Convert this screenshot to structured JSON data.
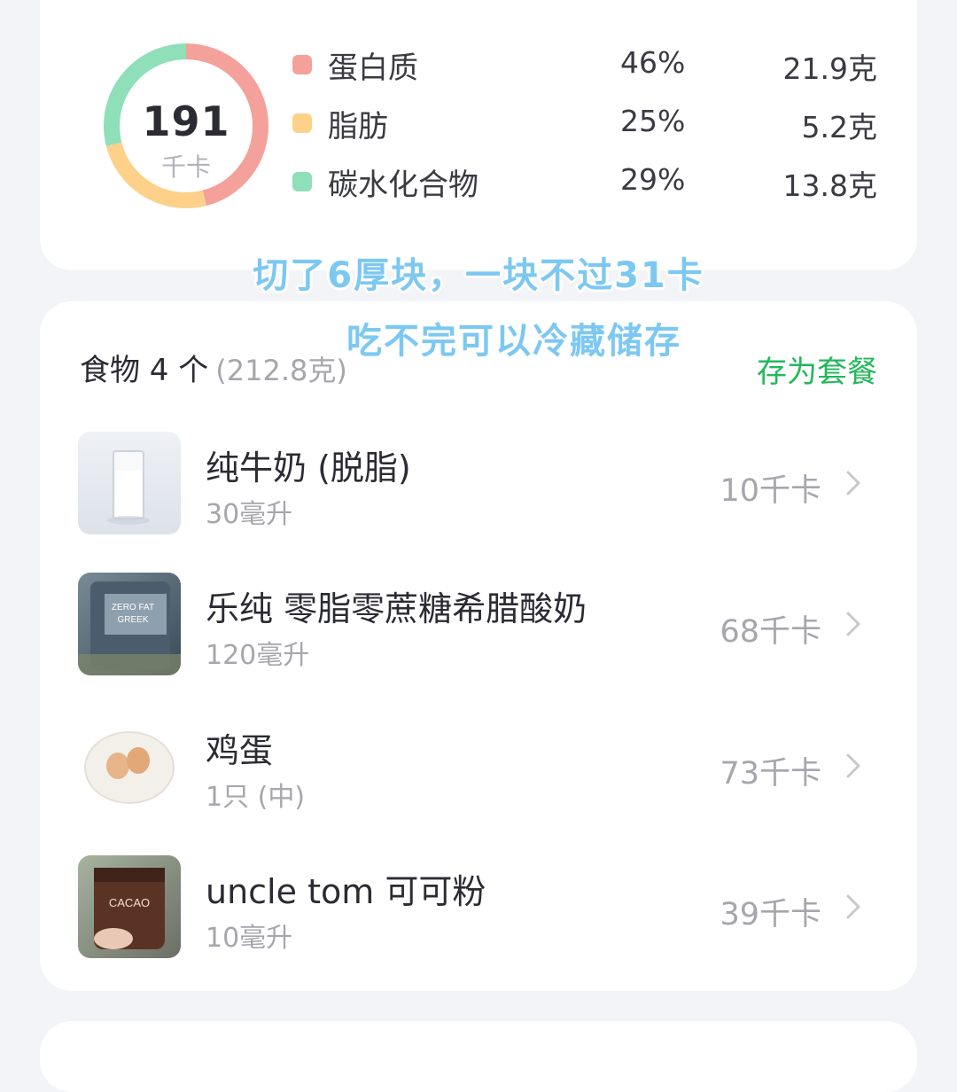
{
  "summary": {
    "calories": "191",
    "calories_unit": "千卡",
    "macros": [
      {
        "name": "蛋白质",
        "percent": "46%",
        "grams": "21.9克",
        "color": "#f4a19b",
        "fraction": 0.46
      },
      {
        "name": "脂肪",
        "percent": "25%",
        "grams": "5.2克",
        "color": "#fdd18a",
        "fraction": 0.25
      },
      {
        "name": "碳水化合物",
        "percent": "29%",
        "grams": "13.8克",
        "color": "#8fdfb9",
        "fraction": 0.29
      }
    ]
  },
  "note": {
    "line1": "切了6厚块，一块不过31卡",
    "line2": "吃不完可以冷藏储存"
  },
  "food_list": {
    "title": "食物 4 个",
    "total_weight": "(212.8克)",
    "save_meal_label": "存为套餐",
    "items": [
      {
        "name": "纯牛奶 (脱脂)",
        "qty": "30毫升",
        "kcal": "10千卡",
        "icon": "milk-glass-photo"
      },
      {
        "name": "乐纯 零脂零蔗糖希腊酸奶",
        "qty": "120毫升",
        "kcal": "68千卡",
        "icon": "yogurt-package-photo"
      },
      {
        "name": "鸡蛋",
        "qty": "1只 (中)",
        "kcal": "73千卡",
        "icon": "eggs-plate-photo"
      },
      {
        "name": "uncle tom 可可粉",
        "qty": "10毫升",
        "kcal": "39千卡",
        "icon": "cacao-bag-photo"
      }
    ]
  },
  "colors": {
    "accent_green": "#22b859",
    "note_blue": "#7cc8f2"
  }
}
